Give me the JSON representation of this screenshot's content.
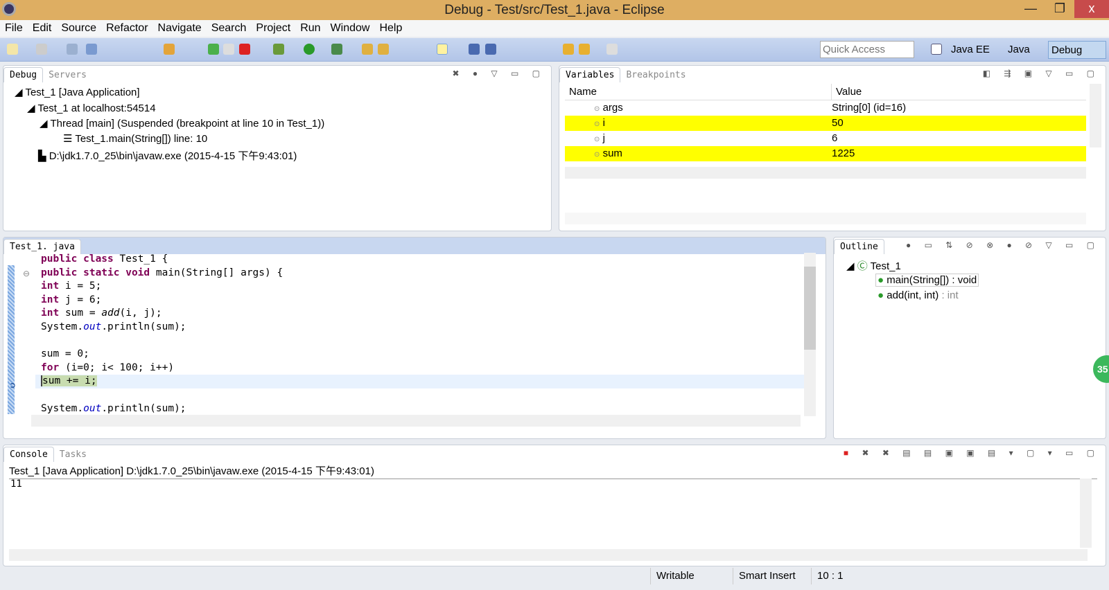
{
  "window": {
    "title": "Debug - Test/src/Test_1.java - Eclipse",
    "minimize": "—",
    "maximize": "❐",
    "close": "x"
  },
  "menu": [
    "File",
    "Edit",
    "Source",
    "Refactor",
    "Navigate",
    "Search",
    "Project",
    "Run",
    "Window",
    "Help"
  ],
  "toolbar": {
    "quick_access_placeholder": "Quick Access",
    "perspectives": [
      "Java EE",
      "Java",
      "Debug"
    ],
    "active_perspective": "Debug"
  },
  "debug_panel": {
    "tabs": [
      "Debug",
      "Servers"
    ],
    "tree": [
      "Test_1 [Java Application]",
      "Test_1 at localhost:54514",
      "Thread [main] (Suspended (breakpoint at line 10 in Test_1))",
      "Test_1.main(String[]) line: 10",
      "D:\\jdk1.7.0_25\\bin\\javaw.exe (2015-4-15 下午9:43:01)"
    ]
  },
  "variables_panel": {
    "tabs": [
      "Variables",
      "Breakpoints"
    ],
    "columns": [
      "Name",
      "Value"
    ],
    "rows": [
      {
        "name": "args",
        "value": "String[0]  (id=16)",
        "highlight": false
      },
      {
        "name": "i",
        "value": "50",
        "highlight": true
      },
      {
        "name": "j",
        "value": "6",
        "highlight": false
      },
      {
        "name": "sum",
        "value": "1225",
        "highlight": true
      }
    ]
  },
  "editor": {
    "tab": "Test_1. java",
    "lines": [
      [
        [
          "kw",
          "public class"
        ],
        [
          "",
          "Test_1 {"
        ]
      ],
      [
        [
          "kw",
          "public static void"
        ],
        [
          "",
          "main(String[] args) {"
        ]
      ],
      [
        [
          "kw",
          "int"
        ],
        [
          "",
          "i = 5;"
        ]
      ],
      [
        [
          "kw",
          "int"
        ],
        [
          "",
          "j = 6;"
        ]
      ],
      [
        [
          "kw",
          "int"
        ],
        [
          "",
          "sum = "
        ],
        [
          "it",
          "add"
        ],
        [
          "",
          "(i, j);"
        ]
      ],
      [
        [
          "",
          "System."
        ],
        [
          "fld",
          "out"
        ],
        [
          "",
          ".println(sum);"
        ]
      ],
      [
        [
          "",
          ""
        ]
      ],
      [
        [
          "",
          "sum = 0;"
        ]
      ],
      [
        [
          "kw",
          "for"
        ],
        [
          "",
          "(i=0; i< 100; i++)"
        ]
      ],
      [
        [
          "mark",
          "sum += i;"
        ]
      ],
      [
        [
          "",
          ""
        ]
      ],
      [
        [
          "",
          "System."
        ],
        [
          "fld",
          "out"
        ],
        [
          "",
          ".println(sum);"
        ]
      ]
    ],
    "current_line": 10
  },
  "outline": {
    "tab": "Outline",
    "class": "Test_1",
    "members": [
      {
        "name": "main(String[]) : void"
      },
      {
        "name": "add(int, int)",
        "type": " : int"
      }
    ]
  },
  "console": {
    "tabs": [
      "Console",
      "Tasks"
    ],
    "header": "Test_1 [Java Application] D:\\jdk1.7.0_25\\bin\\javaw.exe (2015-4-15 下午9:43:01)",
    "output": "11"
  },
  "statusbar": {
    "writable": "Writable",
    "insert_mode": "Smart Insert",
    "position": "10 : 1"
  },
  "badge": "35"
}
